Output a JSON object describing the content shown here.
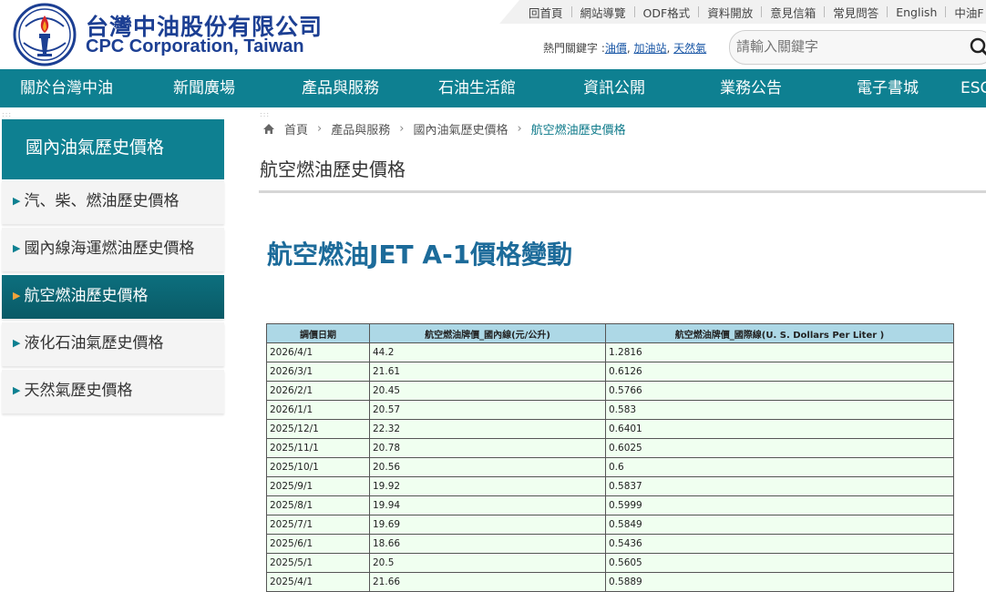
{
  "brand": {
    "name_cn": "台灣中油股份有限公司",
    "name_en": "CPC Corporation, Taiwan"
  },
  "top_links": [
    "回首頁",
    "網站導覽",
    "ODF格式",
    "資料開放",
    "意見信箱",
    "常見問答",
    "English",
    "中油F"
  ],
  "hot_keywords": {
    "label": "熱門關鍵字 :",
    "items": [
      "油價",
      "加油站",
      "天然氣"
    ]
  },
  "search": {
    "placeholder": "請輸入關鍵字"
  },
  "nav": [
    "關於台灣中油",
    "新聞廣場",
    "產品與服務",
    "石油生活館",
    "資訊公開",
    "業務公告",
    "電子書城",
    "ESG"
  ],
  "sidebar": {
    "title": "國內油氣歷史價格",
    "items": [
      "汽、柴、燃油歷史價格",
      "國內線海運燃油歷史價格",
      "航空燃油歷史價格",
      "液化石油氣歷史價格",
      "天然氣歷史價格"
    ],
    "active_index": 2
  },
  "breadcrumb": [
    "首頁",
    "產品與服務",
    "國內油氣歷史價格",
    "航空燃油歷史價格"
  ],
  "page_title": "航空燃油歷史價格",
  "heading": "航空燃油JET A-1價格變動",
  "table": {
    "headers": [
      "調價日期",
      "航空燃油牌價_國內線(元/公升)",
      "航空燃油牌價_國際線(U. S. Dollars Per Liter )"
    ],
    "rows": [
      [
        "2026/4/1",
        "44.2",
        "1.2816"
      ],
      [
        "2026/3/1",
        "21.61",
        "0.6126"
      ],
      [
        "2026/2/1",
        "20.45",
        "0.5766"
      ],
      [
        "2026/1/1",
        "20.57",
        "0.583"
      ],
      [
        "2025/12/1",
        "22.32",
        "0.6401"
      ],
      [
        "2025/11/1",
        "20.78",
        "0.6025"
      ],
      [
        "2025/10/1",
        "20.56",
        "0.6"
      ],
      [
        "2025/9/1",
        "19.92",
        "0.5837"
      ],
      [
        "2025/8/1",
        "19.94",
        "0.5999"
      ],
      [
        "2025/7/1",
        "19.69",
        "0.5849"
      ],
      [
        "2025/6/1",
        "18.66",
        "0.5436"
      ],
      [
        "2025/5/1",
        "20.5",
        "0.5605"
      ],
      [
        "2025/4/1",
        "21.66",
        "0.5889"
      ]
    ]
  },
  "colors": {
    "primary": "#0e8091",
    "brand_blue": "#1c3f93",
    "heading": "#1c6b9a",
    "table_header": "#add8e6",
    "table_cell": "#f0fff0",
    "active_marker": "#f0a33a"
  },
  "icons": {
    "logo": "cpc-torch-logo",
    "search": "search-icon",
    "home": "home-icon"
  }
}
